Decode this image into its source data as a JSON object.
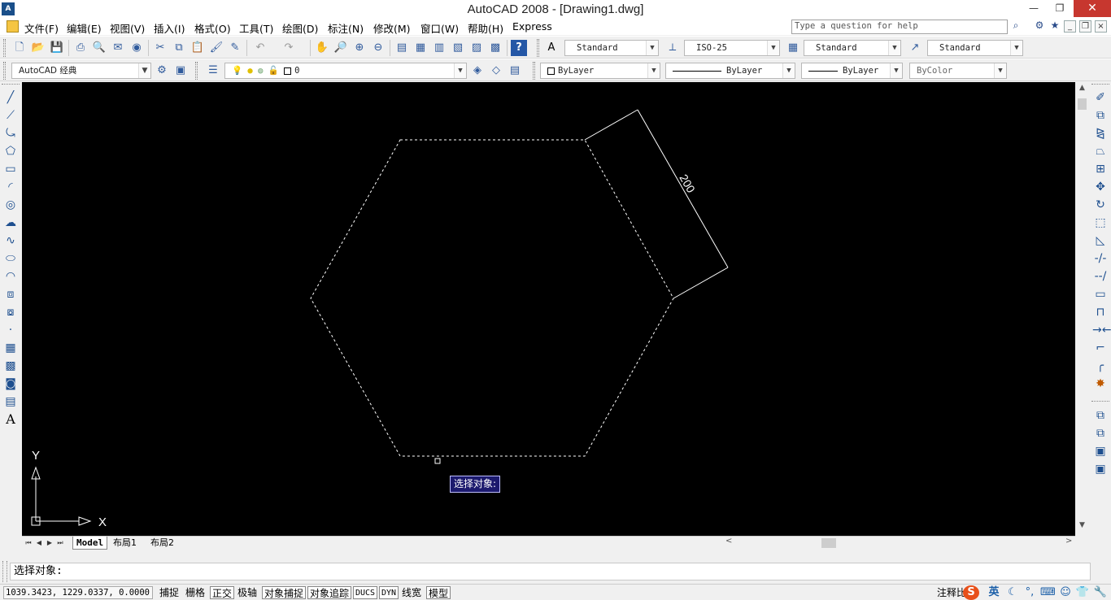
{
  "window": {
    "title": "AutoCAD 2008 - [Drawing1.dwg]",
    "minimize": "—",
    "maximize": "❐",
    "close": "✕"
  },
  "menu": {
    "items": [
      "文件(F)",
      "编辑(E)",
      "视图(V)",
      "插入(I)",
      "格式(O)",
      "工具(T)",
      "绘图(D)",
      "标注(N)",
      "修改(M)",
      "窗口(W)",
      "帮助(H)",
      "Express"
    ],
    "help_placeholder": "Type a question for help"
  },
  "toolbar": {
    "text_style": "Standard",
    "dim_style": "ISO-25",
    "table_style": "Standard",
    "mleader_style": "Standard",
    "workspace": "AutoCAD 经典",
    "layer": "0",
    "color": "ByLayer",
    "linetype": "ByLayer",
    "lineweight": "ByLayer",
    "plot_style": "ByColor"
  },
  "drawing": {
    "dimension_text": "200",
    "prompt_tooltip": "选择对象:",
    "ucs_x": "X",
    "ucs_y": "Y"
  },
  "tabs": {
    "model": "Model",
    "layout1": "布局1",
    "layout2": "布局2"
  },
  "command": {
    "text": "选择对象:"
  },
  "status": {
    "coordinates": "1039.3423, 1229.0337, 0.0000",
    "buttons": [
      "捕捉",
      "栅格",
      "正交",
      "极轴",
      "对象捕捉",
      "对象追踪",
      "DUCS",
      "DYN",
      "线宽",
      "模型"
    ],
    "annotation": "注释比",
    "ime_lang": "英"
  },
  "colors": {
    "canvas": "#000000",
    "close_button": "#c7372f",
    "tooltip_bg": "#1c1a6e"
  }
}
